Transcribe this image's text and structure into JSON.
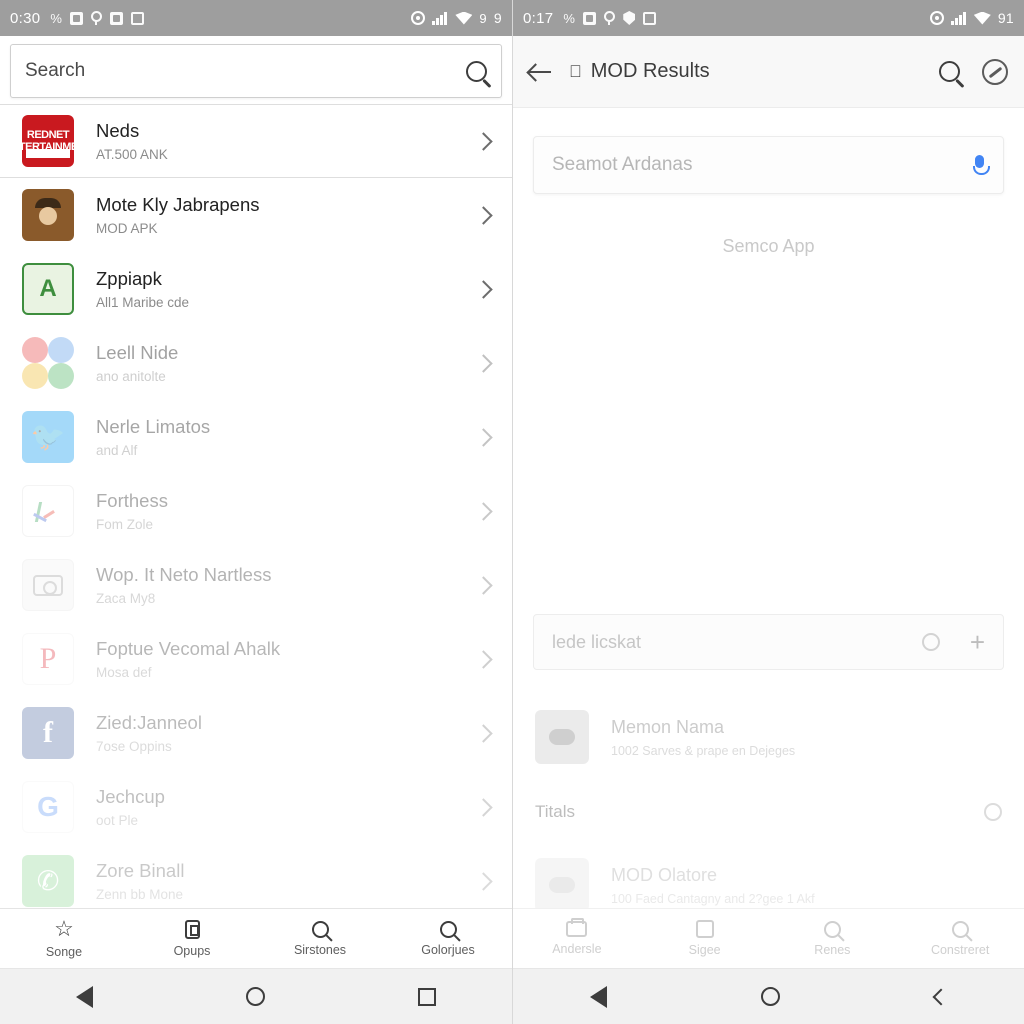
{
  "left": {
    "statusbar": {
      "clock": "0:30",
      "left_icons": [
        "percent-icon",
        "sim-icon",
        "location-pin-icon",
        "image-icon",
        "file-icon"
      ],
      "right_icons": [
        "settings-gear-icon",
        "signal-bars-icon",
        "wifi-icon"
      ],
      "signal_value": "9",
      "battery": "9"
    },
    "search": {
      "placeholder": "Search",
      "icon": "search-icon"
    },
    "list": [
      {
        "title": "Neds",
        "subtitle": "AT.500 ANK",
        "icon": "redmet-app-icon"
      },
      {
        "title": "Mote Kly Jabrapens",
        "subtitle": "MOD APK",
        "icon": "brown-character-app-icon"
      },
      {
        "title": "Zppiapk",
        "subtitle": "All1 Maribe cde",
        "icon": "green-circle-app-icon"
      },
      {
        "title": "Leell Nide",
        "subtitle": "ano anitolte",
        "icon": "photos-app-icon"
      },
      {
        "title": "Nerle Limatos",
        "subtitle": "and Alf",
        "icon": "twitter-app-icon"
      },
      {
        "title": "Forthess",
        "subtitle": "Fom Zole",
        "icon": "sheets-app-icon"
      },
      {
        "title": "Wop. It Neto Nartless",
        "subtitle": "Zaca My8",
        "icon": "camera-app-icon"
      },
      {
        "title": "Foptue Vecomal Ahalk",
        "subtitle": "Mosa def",
        "icon": "pinterest-app-icon"
      },
      {
        "title": "Zied:Janneol",
        "subtitle": "7ose Oppins",
        "icon": "facebook-app-icon"
      },
      {
        "title": "Jechcup",
        "subtitle": "oot Ple",
        "icon": "google-app-icon"
      },
      {
        "title": "Zore Binall",
        "subtitle": "Zenn bb Mone",
        "icon": "whatsapp-app-icon"
      }
    ],
    "bottomnav": [
      {
        "label": "Songe",
        "icon": "star-icon"
      },
      {
        "label": "Opups",
        "icon": "box-icon"
      },
      {
        "label": "Sirstones",
        "icon": "search-icon"
      },
      {
        "label": "Golorjues",
        "icon": "search-icon"
      }
    ],
    "sysnav": [
      "back-triangle-icon",
      "home-circle-icon",
      "recents-square-icon"
    ]
  },
  "right": {
    "statusbar": {
      "clock": "0:17",
      "left_icons": [
        "percent-icon",
        "message-icon",
        "location-pin-icon",
        "shield-icon",
        "file-icon"
      ],
      "right_icons": [
        "settings-gear-icon",
        "signal-bars-icon",
        "wifi-icon"
      ],
      "battery": "91"
    },
    "appbar": {
      "back": "back-arrow-icon",
      "brand_icon": "apple-icon",
      "title": "MOD Results",
      "search_icon": "search-icon",
      "compass_icon": "compass-icon"
    },
    "search_card": {
      "placeholder": "Seamot Ardanas",
      "mic": "microphone-icon"
    },
    "subtitle": "Semco App",
    "ghost_card": {
      "label": "lede licskat",
      "circle": "progress-circle-icon",
      "plus": "add-icon"
    },
    "ghost_row": {
      "title": "Memon Nama",
      "subtitle": "1002 Sarves & prape en Dejeges",
      "icon": "cloud-tile-icon"
    },
    "section": {
      "label": "Titals",
      "circle": "progress-circle-icon"
    },
    "ghost_row2": {
      "title": "MOD Olatore",
      "subtitle": "100 Faed Cantagny and 2?gee 1 Akf",
      "icon": "placeholder-tile-icon"
    },
    "bottomnav": [
      {
        "label": "Andersle",
        "icon": "folder-icon"
      },
      {
        "label": "Sigee",
        "icon": "box-icon"
      },
      {
        "label": "Renes",
        "icon": "search-icon"
      },
      {
        "label": "Constreret",
        "icon": "search-icon"
      }
    ],
    "sysnav": [
      "back-triangle-icon",
      "home-circle-icon",
      "back-chevron-icon"
    ]
  },
  "colors": {
    "statusbar_bg": "#9e9e9e",
    "accent_blue": "#4285f4",
    "chrome_gray": "#f8f8f8"
  }
}
